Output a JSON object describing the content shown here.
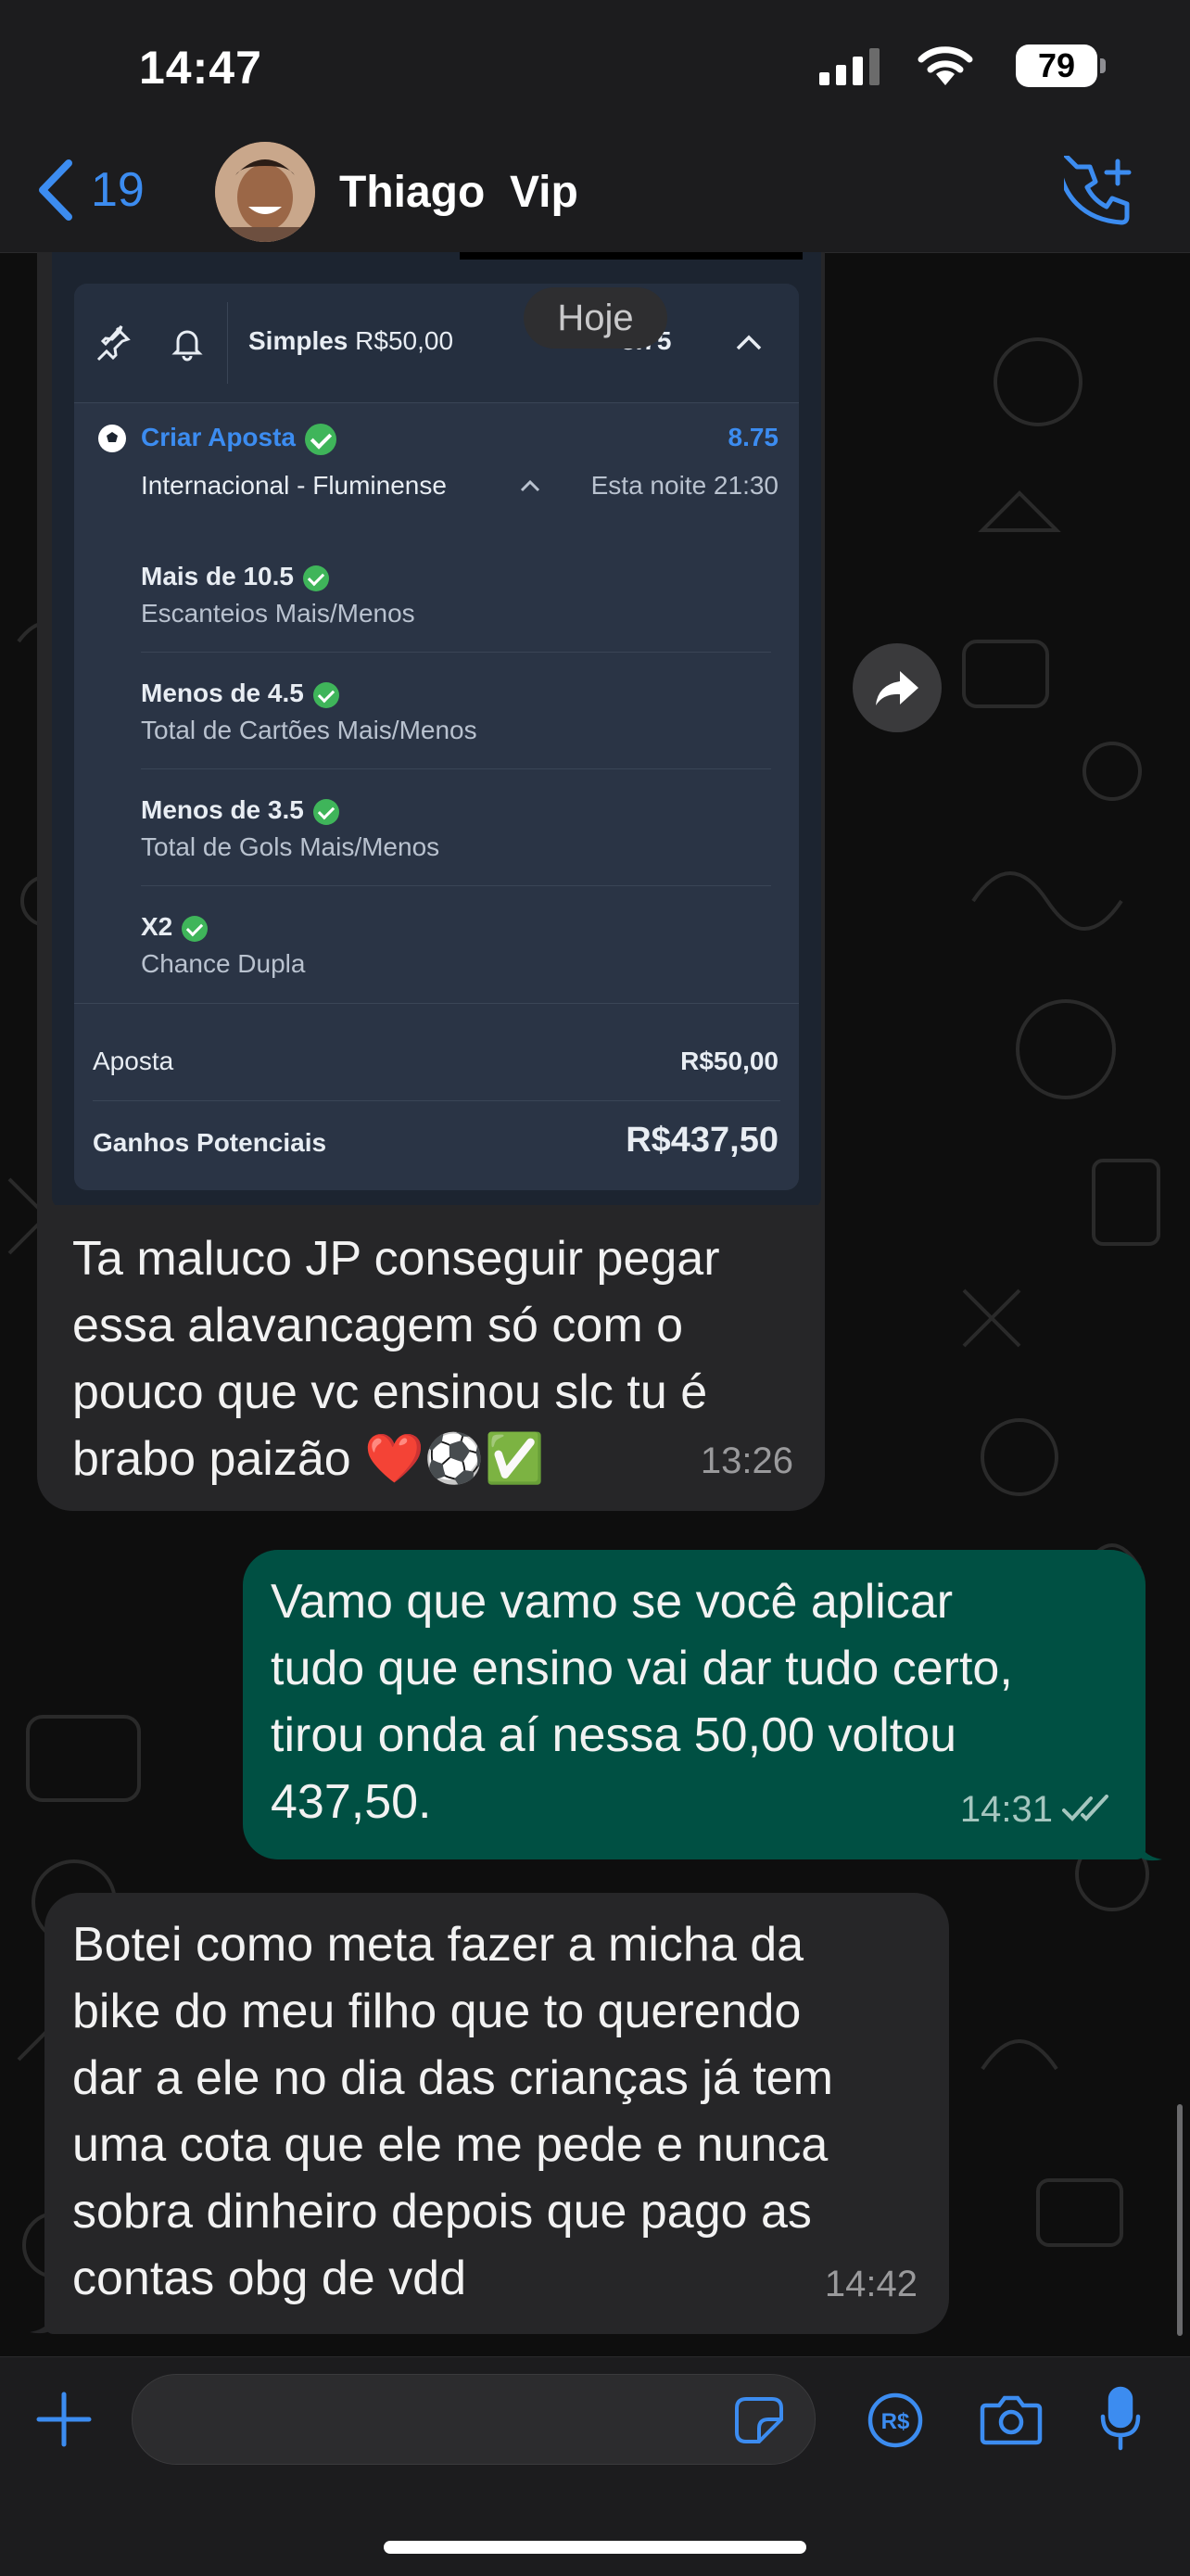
{
  "status_bar": {
    "time": "14:47",
    "battery": "79"
  },
  "header": {
    "back_count": "19",
    "contact_name": "Thiago  Vip"
  },
  "date_pill": "Hoje",
  "bet_slip": {
    "bet_type": "Simples",
    "bet_type_amount": "R$50,00",
    "odds_partial": "8.75",
    "bet_builder_label": "Criar Aposta",
    "total_odds": "8.75",
    "match": "Internacional - Fluminense",
    "match_time": "Esta noite 21:30",
    "selections": [
      {
        "title": "Mais de 10.5",
        "market": "Escanteios Mais/Menos"
      },
      {
        "title": "Menos de 4.5",
        "market": "Total de Cartões Mais/Menos"
      },
      {
        "title": "Menos de 3.5",
        "market": "Total de Gols Mais/Menos"
      },
      {
        "title": "X2",
        "market": "Chance Dupla"
      }
    ],
    "stake_label": "Aposta",
    "stake_value": "R$50,00",
    "returns_label": "Ganhos Potenciais",
    "returns_value": "R$437,50"
  },
  "messages": [
    {
      "direction": "incoming",
      "text": "Ta maluco JP conseguir pegar\nessa alavancagem só com o\npouco que vc ensinou slc tu é\nbrabo paizão ❤️⚽✅",
      "time": "13:26"
    },
    {
      "direction": "outgoing",
      "text": "Vamo que vamo se você aplicar\ntudo que ensino vai dar tudo certo,\ntirou onda aí nessa 50,00 voltou\n437,50.",
      "time": "14:31"
    },
    {
      "direction": "incoming",
      "text": "Botei como meta fazer a micha da\nbike do meu filho que to querendo\ndar a ele no dia das crianças já tem\numa cota que ele me pede e nunca\nsobra dinheiro depois que pago as\ncontas obg de vdd",
      "time": "14:42"
    }
  ],
  "colors": {
    "accent": "#3c8cf0",
    "outgoing_bubble": "#005043",
    "incoming_bubble": "#262628",
    "check_green": "#3fb55a"
  }
}
